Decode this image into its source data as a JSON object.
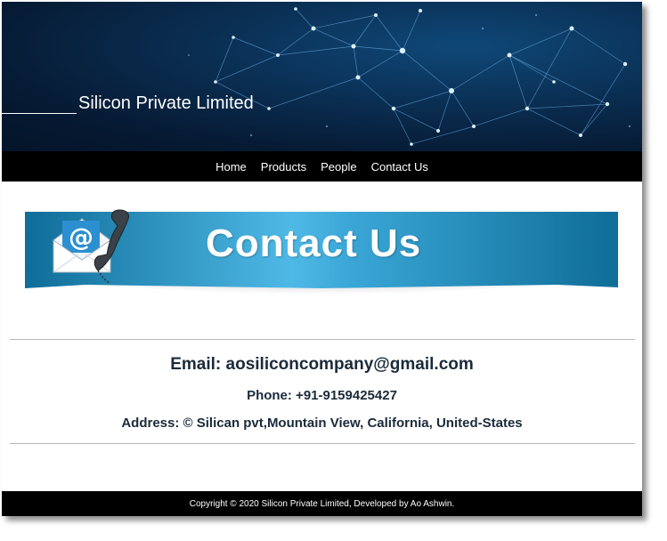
{
  "header": {
    "brand": "Silicon Private Limited"
  },
  "nav": {
    "items": [
      "Home",
      "Products",
      "People",
      "Contact Us"
    ]
  },
  "banner": {
    "title": "Contact Us",
    "email_symbol": "@"
  },
  "contact": {
    "email": "Email: aosiliconcompany@gmail.com",
    "phone": "Phone: +91-9159425427",
    "address": "Address: © Silican pvt,Mountain View, California, United-States"
  },
  "footer": {
    "copyright": "Copyright © 2020 Silicon Private Limited, Developed by Ao Ashwin."
  },
  "colors": {
    "header_bg": "#0a2e52",
    "nav_bg": "#000000",
    "banner_blue": "#1a7aa6",
    "text": "#1b2a3a"
  },
  "icons": [
    "network-graphic",
    "email-envelope-icon",
    "telephone-icon"
  ]
}
